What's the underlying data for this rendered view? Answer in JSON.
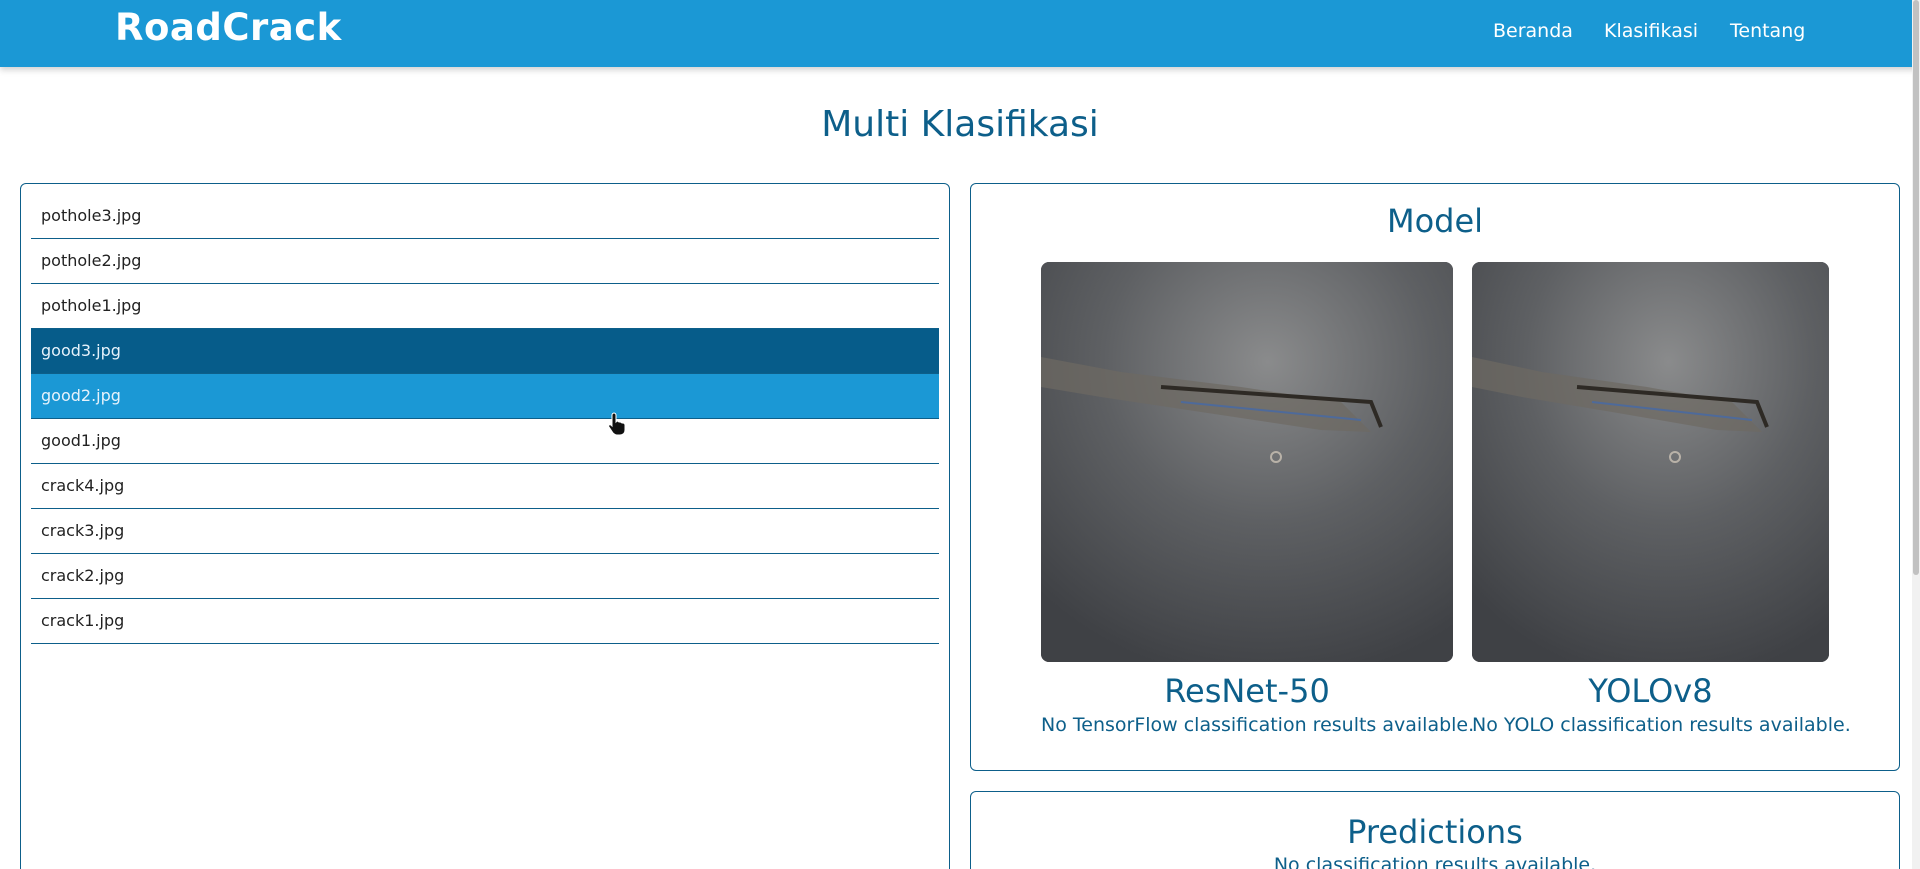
{
  "app": {
    "logo_text": "RoadCrack",
    "nav": [
      "Beranda",
      "Klasifikasi",
      "Tentang"
    ]
  },
  "page": {
    "title": "Multi Klasifikasi"
  },
  "files": {
    "items": [
      {
        "name": "pothole3.jpg",
        "state": "normal"
      },
      {
        "name": "pothole2.jpg",
        "state": "normal"
      },
      {
        "name": "pothole1.jpg",
        "state": "normal"
      },
      {
        "name": "good3.jpg",
        "state": "selected"
      },
      {
        "name": "good2.jpg",
        "state": "hover"
      },
      {
        "name": "good1.jpg",
        "state": "normal"
      },
      {
        "name": "crack4.jpg",
        "state": "normal"
      },
      {
        "name": "crack3.jpg",
        "state": "normal"
      },
      {
        "name": "crack2.jpg",
        "state": "normal"
      },
      {
        "name": "crack1.jpg",
        "state": "normal"
      }
    ]
  },
  "model": {
    "title": "Model",
    "models": [
      {
        "name": "ResNet-50",
        "result": "No TensorFlow classification results available."
      },
      {
        "name": "YOLOv8",
        "result": "No YOLO classification results available."
      }
    ]
  },
  "predictions": {
    "title": "Predictions",
    "text": "No classification results available."
  },
  "colors": {
    "primary": "#1b98d5",
    "dark": "#0d5f8a",
    "selected": "#065c8a"
  }
}
